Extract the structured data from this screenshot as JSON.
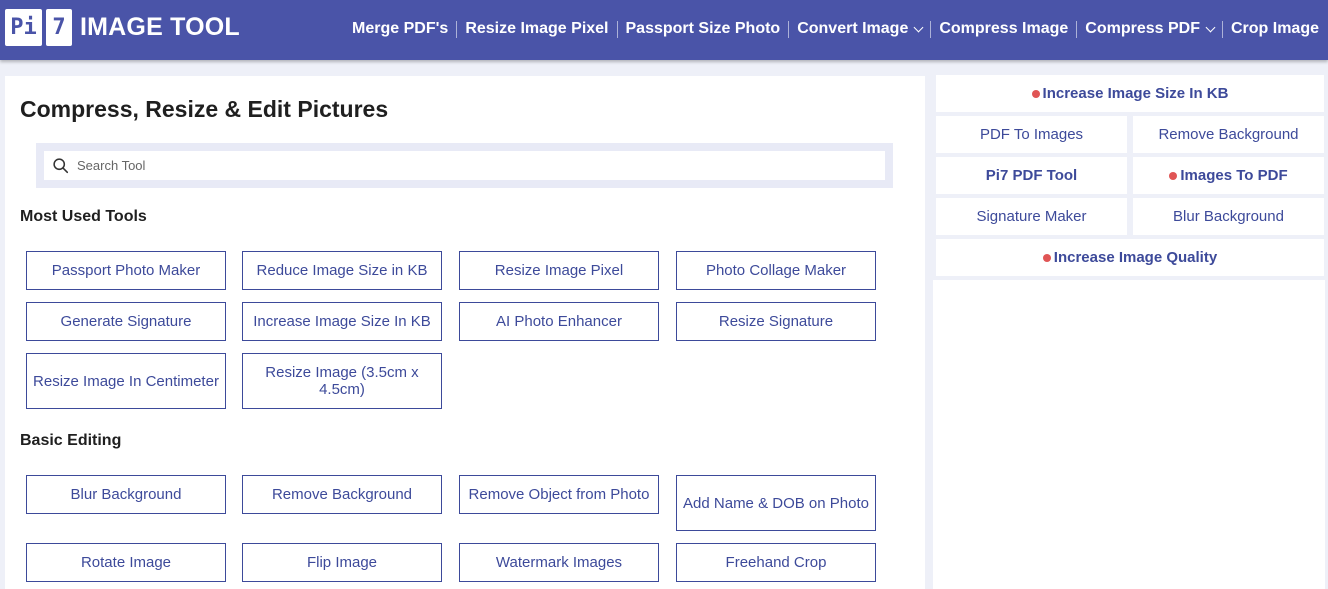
{
  "header": {
    "logo_pi": "Pi",
    "logo_seven": "7",
    "logo_text": "IMAGE TOOL",
    "nav": [
      {
        "label": "Merge PDF's"
      },
      {
        "label": "Resize Image Pixel"
      },
      {
        "label": "Passport Size Photo"
      },
      {
        "label": "Convert Image",
        "dropdown": true
      },
      {
        "label": "Compress Image"
      },
      {
        "label": "Compress PDF",
        "dropdown": true
      },
      {
        "label": "Crop Image"
      }
    ]
  },
  "main": {
    "title": "Compress, Resize & Edit Pictures",
    "search": {
      "placeholder": "Search Tool",
      "value": ""
    },
    "sections": [
      {
        "title": "Most Used Tools",
        "tools": [
          "Passport Photo Maker",
          "Reduce Image Size in KB",
          "Resize Image Pixel",
          "Photo Collage Maker",
          "Generate Signature",
          "Increase Image Size In KB",
          "AI Photo Enhancer",
          "Resize Signature",
          "Resize Image In Centimeter",
          "Resize Image (3.5cm x 4.5cm)"
        ]
      },
      {
        "title": "Basic Editing",
        "tools": [
          "Blur Background",
          "Remove Background",
          "Remove Object from Photo",
          "Add Name & DOB on Photo",
          "Rotate Image",
          "Flip Image",
          "Watermark Images",
          "Freehand Crop"
        ]
      }
    ]
  },
  "sidebar": {
    "links": [
      {
        "label": "Increase Image Size In KB",
        "highlight": true
      },
      {
        "label": "PDF To Images"
      },
      {
        "label": "Remove Background"
      },
      {
        "label": "Pi7 PDF Tool",
        "bold": true
      },
      {
        "label": "Images To PDF",
        "highlight": true
      },
      {
        "label": "Signature Maker"
      },
      {
        "label": "Blur Background"
      },
      {
        "label": "Increase Image Quality",
        "highlight": true
      }
    ]
  },
  "colors": {
    "header_bg": "#4a54a8",
    "accent": "#3d4a9a",
    "highlight_dot": "#e05555",
    "page_bg": "#eef0f8"
  }
}
